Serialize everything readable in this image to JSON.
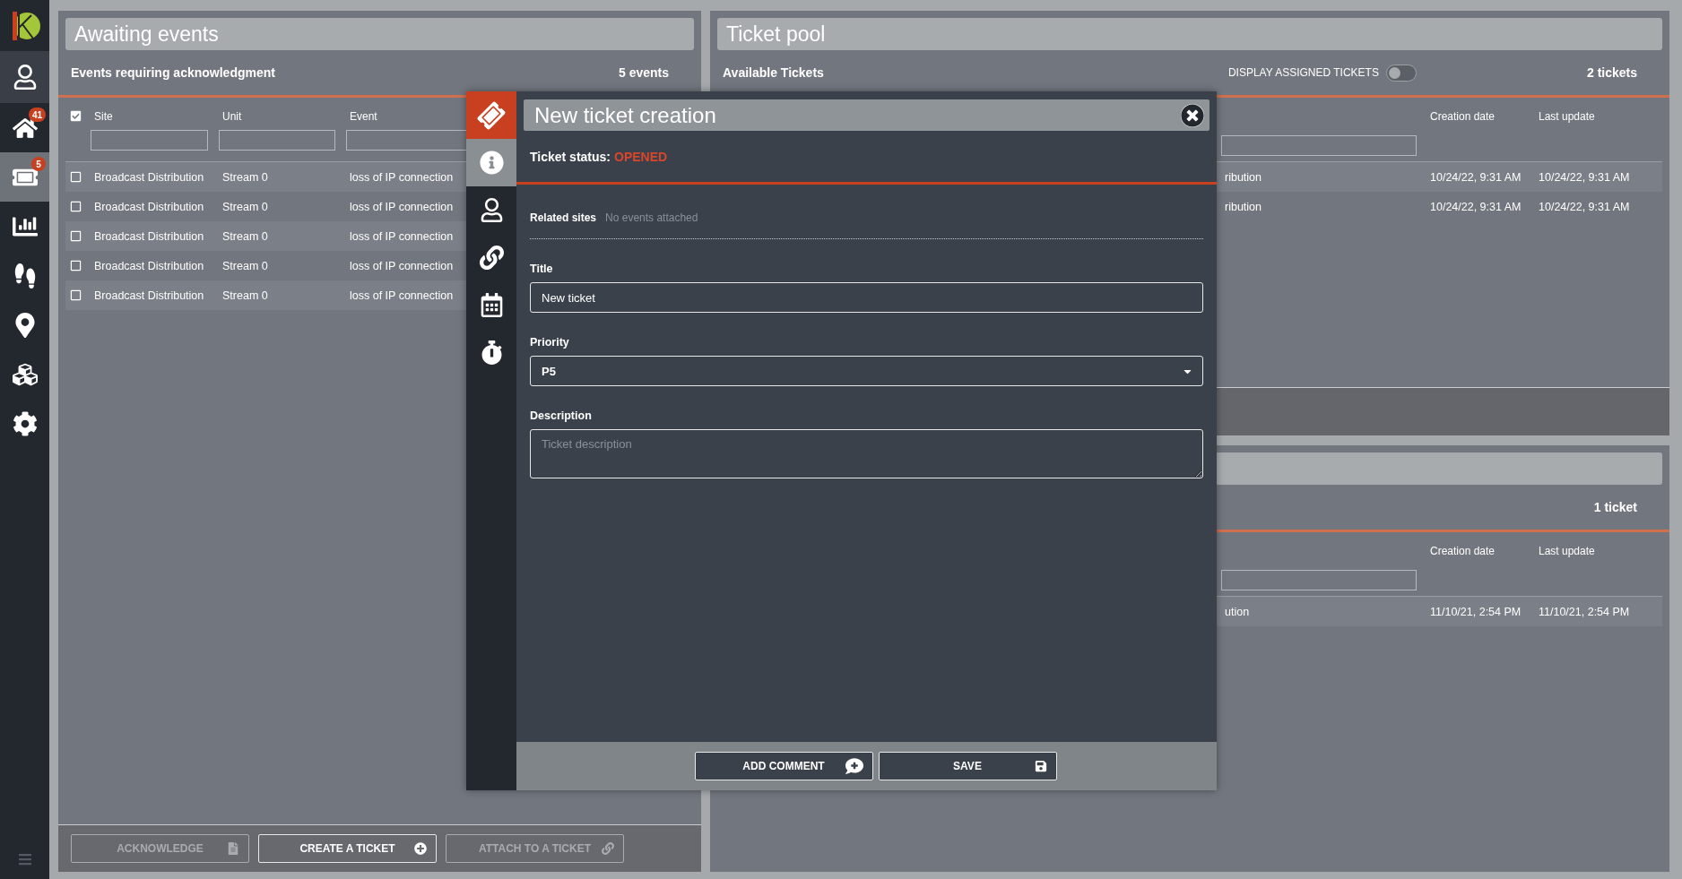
{
  "sidebar": {
    "items": [
      {
        "selected": false
      },
      {
        "selected": false,
        "badge": "41"
      },
      {
        "selected": true,
        "badge": "5"
      },
      {
        "selected": false
      },
      {
        "selected": false
      },
      {
        "selected": false
      },
      {
        "selected": false
      },
      {
        "selected": false
      }
    ]
  },
  "awaiting": {
    "title": "Awaiting events",
    "subtitle": "Events requiring acknowledgment",
    "count": "5 events",
    "header_checked": true,
    "columns": [
      "Site",
      "Unit",
      "Event"
    ],
    "rows": [
      {
        "checked": false,
        "cells": [
          "Broadcast Distribution",
          "Stream 0",
          "loss of IP connection"
        ]
      },
      {
        "checked": false,
        "cells": [
          "Broadcast Distribution",
          "Stream 0",
          "loss of IP connection"
        ]
      },
      {
        "checked": false,
        "cells": [
          "Broadcast Distribution",
          "Stream 0",
          "loss of IP connection"
        ]
      },
      {
        "checked": false,
        "cells": [
          "Broadcast Distribution",
          "Stream 0",
          "loss of IP connection"
        ]
      },
      {
        "checked": false,
        "cells": [
          "Broadcast Distribution",
          "Stream 0",
          "loss of IP connection"
        ]
      }
    ],
    "buttons": [
      {
        "label": "ACKNOWLEDGE",
        "disabled": true
      },
      {
        "label": "CREATE A TICKET",
        "disabled": false
      },
      {
        "label": "ATTACH TO A TICKET",
        "disabled": true
      }
    ]
  },
  "ticket_pool": {
    "title": "Ticket pool",
    "subtitle": "Available Tickets",
    "toggle": {
      "label": "DISPLAY ASSIGNED TICKETS",
      "on": false
    },
    "count": "2 tickets",
    "columns": [
      "",
      "Creation date",
      "Last update"
    ],
    "rows": [
      {
        "cells": [
          "ribution",
          "10/24/22, 9:31 AM",
          "10/24/22, 9:31 AM"
        ]
      },
      {
        "cells": [
          "ribution",
          "10/24/22, 9:31 AM",
          "10/24/22, 9:31 AM"
        ]
      }
    ]
  },
  "second_pool": {
    "count": "1 ticket",
    "columns": [
      "",
      "Creation date",
      "Last update"
    ],
    "rows": [
      {
        "cells": [
          "ution",
          "11/10/21, 2:54 PM",
          "11/10/21, 2:54 PM"
        ]
      }
    ]
  },
  "modal": {
    "title": "New ticket creation",
    "tabs": [
      {
        "selected": true
      },
      {
        "selected": false
      },
      {
        "selected": false
      },
      {
        "selected": false
      },
      {
        "selected": false
      }
    ],
    "status_label": "Ticket status:",
    "status_value": "OPENED",
    "related_label": "Related sites",
    "related_value": "No events attached",
    "title_label": "Title",
    "title_value": "New ticket",
    "priority_label": "Priority",
    "priority_value": "P5",
    "description_label": "Description",
    "description_placeholder": "Ticket description",
    "buttons": [
      {
        "label": "ADD COMMENT"
      },
      {
        "label": "SAVE"
      }
    ]
  }
}
